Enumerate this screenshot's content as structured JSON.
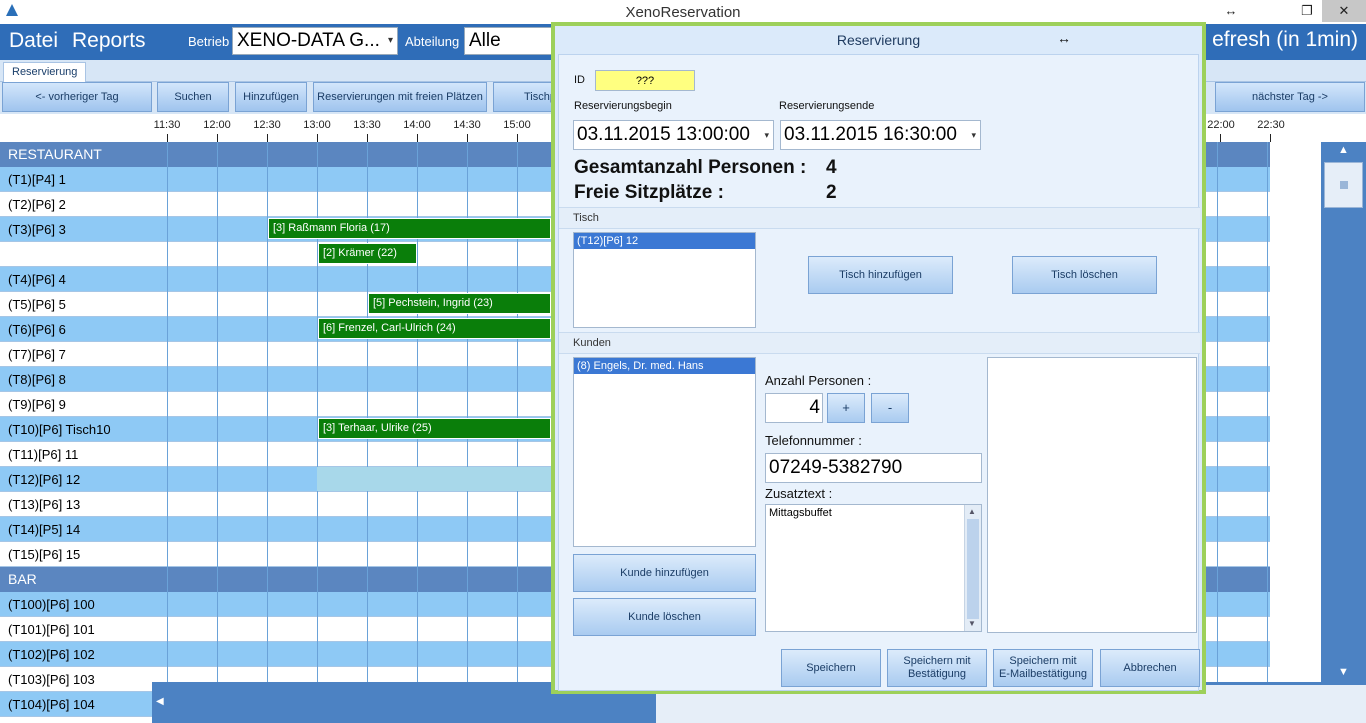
{
  "window": {
    "title": "XenoReservation",
    "move_glyph": "↔",
    "maximize_glyph": "❐",
    "close_glyph": "✕"
  },
  "menubar": {
    "file": "Datei",
    "reports": "Reports",
    "betrieb_label": "Betrieb",
    "betrieb_value": "XENO-DATA G...",
    "abteilung_label": "Abteilung",
    "abteilung_value": "Alle",
    "refresh": "efresh (in 1min)"
  },
  "tabs": {
    "reservierung": "Reservierung"
  },
  "toolbar": {
    "prev_day": "<- vorheriger Tag",
    "search": "Suchen",
    "add": "Hinzufügen",
    "free_seats": "Reservierungen mit freien Plätzen",
    "table_plan": "Tischp",
    "next_day": "nächster Tag ->"
  },
  "timeline": {
    "ticks": [
      "11:30",
      "12:00",
      "12:30",
      "13:00",
      "13:30",
      "14:00",
      "14:30",
      "15:00"
    ],
    "ticks_right": [
      "22:00",
      "22:30"
    ]
  },
  "rows": [
    {
      "label": "RESTAURANT",
      "kind": "section"
    },
    {
      "label": "(T1)[P4] 1",
      "kind": "blue"
    },
    {
      "label": "(T2)[P6] 2",
      "kind": "white"
    },
    {
      "label": "(T3)[P6] 3",
      "kind": "blue"
    },
    {
      "label": "",
      "kind": "white"
    },
    {
      "label": "(T4)[P6] 4",
      "kind": "blue"
    },
    {
      "label": "(T5)[P6] 5",
      "kind": "white"
    },
    {
      "label": "(T6)[P6] 6",
      "kind": "blue"
    },
    {
      "label": "(T7)[P6] 7",
      "kind": "white"
    },
    {
      "label": "(T8)[P6] 8",
      "kind": "blue"
    },
    {
      "label": "(T9)[P6] 9",
      "kind": "white"
    },
    {
      "label": "(T10)[P6] Tisch10",
      "kind": "blue"
    },
    {
      "label": "(T11)[P6] 11",
      "kind": "white"
    },
    {
      "label": "(T12)[P6] 12",
      "kind": "blue"
    },
    {
      "label": "(T13)[P6] 13",
      "kind": "white"
    },
    {
      "label": "(T14)[P5] 14",
      "kind": "blue"
    },
    {
      "label": "(T15)[P6] 15",
      "kind": "white"
    },
    {
      "label": "BAR",
      "kind": "section"
    },
    {
      "label": "(T100)[P6] 100",
      "kind": "blue"
    },
    {
      "label": "(T101)[P6] 101",
      "kind": "white"
    },
    {
      "label": "(T102)[P6] 102",
      "kind": "blue"
    },
    {
      "label": "(T103)[P6] 103",
      "kind": "white"
    },
    {
      "label": "(T104)[P6] 104",
      "kind": "blue"
    }
  ],
  "reservations": [
    {
      "row": 3,
      "start": "12:30",
      "text": "[3] Raßmann Floria (17)"
    },
    {
      "row": 4,
      "start": "13:00",
      "end": "14:00",
      "text": "[2] Krämer (22)"
    },
    {
      "row": 6,
      "start": "13:30",
      "text": "[5] Pechstein, Ingrid (23)"
    },
    {
      "row": 7,
      "start": "13:00",
      "text": "[6] Frenzel, Carl-Ulrich (24)"
    },
    {
      "row": 11,
      "start": "13:00",
      "text": "[3] Terhaar, Ulrike (25)"
    }
  ],
  "selection": {
    "row": 13,
    "start": "13:00"
  },
  "dialog": {
    "title": "Reservierung",
    "move_glyph": "↔",
    "id_label": "ID",
    "id_value": "???",
    "begin_label": "Reservierungsbegin",
    "begin_value": "03.11.2015 13:00:00",
    "end_label": "Reservierungsende",
    "end_value": "03.11.2015 16:30:00",
    "total_label": "Gesamtanzahl Personen :",
    "total_value": "4",
    "free_label": "Freie Sitzplätze :",
    "free_value": "2",
    "tisch_section": "Tisch",
    "tables": [
      "(T12)[P6] 12"
    ],
    "add_table": "Tisch hinzufügen",
    "delete_table": "Tisch löschen",
    "kunden_section": "Kunden",
    "customers": [
      "(8) Engels, Dr. med. Hans"
    ],
    "persons_label": "Anzahl Personen :",
    "persons_value": "4",
    "plus": "+",
    "minus": "-",
    "phone_label": "Telefonnummer :",
    "phone_value": "07249-5382790",
    "extra_label": "Zusatztext :",
    "extra_value": "Mittagsbuffet",
    "add_customer": "Kunde hinzufügen",
    "delete_customer": "Kunde löschen",
    "save": "Speichern",
    "save_confirm_1": "Speichern mit",
    "save_confirm_2": "Bestätigung",
    "save_mail_1": "Speichern mit",
    "save_mail_2": "E-Mailbestätigung",
    "cancel": "Abbrechen"
  },
  "colors": {
    "menubar": "#2f6db8",
    "reservation": "#0a7e0a",
    "row_blue": "#8ec9f5",
    "dialog_border": "#9dd05a",
    "id_highlight": "#ffff80"
  }
}
